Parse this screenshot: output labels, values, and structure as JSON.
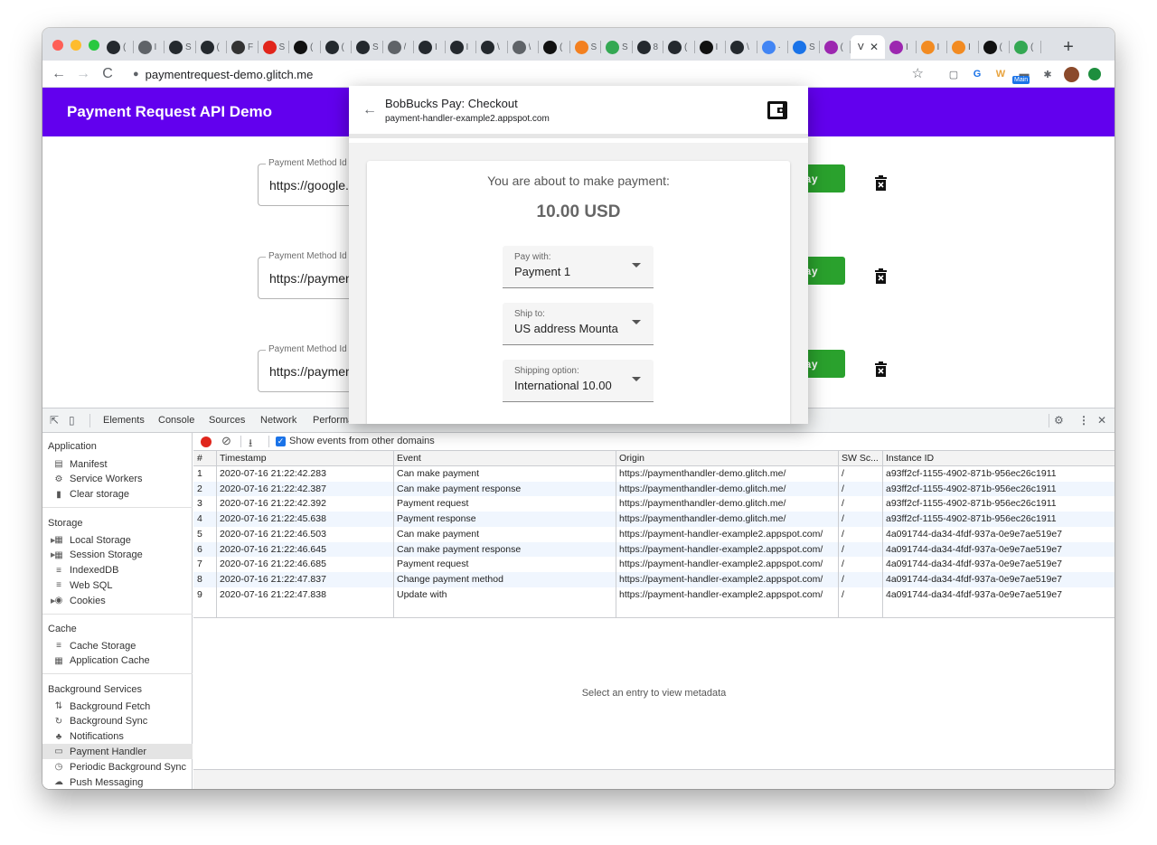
{
  "browser": {
    "tabs": [
      {
        "icon": "github-icon",
        "text": "(",
        "color": "#24292e"
      },
      {
        "icon": "globe-icon",
        "text": "I",
        "color": "#5f6368"
      },
      {
        "icon": "github-icon",
        "text": "S",
        "color": "#24292e"
      },
      {
        "icon": "github-icon",
        "text": "(",
        "color": "#24292e"
      },
      {
        "icon": "apple-dev-icon",
        "text": "F",
        "color": "#333333"
      },
      {
        "icon": "adobe-icon",
        "text": "S",
        "color": "#e1251b"
      },
      {
        "icon": "codepen-icon",
        "text": "(",
        "color": "#111111"
      },
      {
        "icon": "github-icon",
        "text": "(",
        "color": "#24292e"
      },
      {
        "icon": "github-icon",
        "text": "S",
        "color": "#24292e"
      },
      {
        "icon": "globe-icon",
        "text": "/",
        "color": "#5f6368"
      },
      {
        "icon": "github-icon",
        "text": "I",
        "color": "#24292e"
      },
      {
        "icon": "github-icon",
        "text": "I",
        "color": "#24292e"
      },
      {
        "icon": "github-icon",
        "text": "\\",
        "color": "#24292e"
      },
      {
        "icon": "globe-icon",
        "text": "\\",
        "color": "#5f6368"
      },
      {
        "icon": "nyt-icon",
        "text": "(",
        "color": "#111111"
      },
      {
        "icon": "cloudflare-icon",
        "text": "S",
        "color": "#f38020"
      },
      {
        "icon": "glitch-icon",
        "text": "S",
        "color": "#34a853"
      },
      {
        "icon": "github-icon",
        "text": "8",
        "color": "#24292e"
      },
      {
        "icon": "github-icon",
        "text": "(",
        "color": "#24292e"
      },
      {
        "icon": "notion-icon",
        "text": "I",
        "color": "#111111"
      },
      {
        "icon": "github-icon",
        "text": "\\",
        "color": "#24292e"
      },
      {
        "icon": "gcloud-icon",
        "text": "·",
        "color": "#4285f4"
      },
      {
        "icon": "terminal-icon",
        "text": "S",
        "color": "#1a73e8"
      },
      {
        "icon": "stack-icon",
        "text": "(",
        "color": "#9c27b0"
      },
      {
        "icon": "vue-tab",
        "text": "V",
        "color": "#ffffff",
        "active": true
      },
      {
        "icon": "stack-icon",
        "text": "I",
        "color": "#9c27b0"
      },
      {
        "icon": "w3-icon",
        "text": "I",
        "color": "#f28b22"
      },
      {
        "icon": "w3-icon",
        "text": "I",
        "color": "#f28b22"
      },
      {
        "icon": "square-icon",
        "text": "(",
        "color": "#111111"
      },
      {
        "icon": "glitch-icon",
        "text": "(",
        "color": "#34a853"
      }
    ],
    "url": "paymentrequest-demo.glitch.me",
    "extension_badge": "Main"
  },
  "page": {
    "title": "Payment Request API Demo",
    "method_label": "Payment Method Id",
    "rows": [
      {
        "value": "https://google.",
        "button": "ay"
      },
      {
        "value": "https://paymen",
        "button": "ay"
      },
      {
        "value": "https://paymen",
        "button": "ay"
      }
    ]
  },
  "dialog": {
    "title": "BobBucks Pay: Checkout",
    "origin": "payment-handler-example2.appspot.com",
    "message": "You are about to make payment:",
    "amount": "10.00 USD",
    "pay_with_label": "Pay with:",
    "pay_with_value": "Payment 1",
    "ship_to_label": "Ship to:",
    "ship_to_value": "US address Mountain View",
    "shipping_option_label": "Shipping option:",
    "shipping_option_value": "International 10.00"
  },
  "devtools": {
    "tabs": [
      "Elements",
      "Console",
      "Sources",
      "Network",
      "Performa"
    ],
    "sidebar": {
      "application_head": "Application",
      "application_items": [
        "Manifest",
        "Service Workers",
        "Clear storage"
      ],
      "storage_head": "Storage",
      "storage_items": [
        "Local Storage",
        "Session Storage",
        "IndexedDB",
        "Web SQL",
        "Cookies"
      ],
      "cache_head": "Cache",
      "cache_items": [
        "Cache Storage",
        "Application Cache"
      ],
      "bg_head": "Background Services",
      "bg_items": [
        "Background Fetch",
        "Background Sync",
        "Notifications",
        "Payment Handler",
        "Periodic Background Sync",
        "Push Messaging"
      ]
    },
    "toolbar_checkbox_label": "Show events from other domains",
    "columns": [
      "#",
      "Timestamp",
      "Event",
      "Origin",
      "SW Sc...",
      "Instance ID"
    ],
    "rows": [
      [
        "1",
        "2020-07-16 21:22:42.283",
        "Can make payment",
        "https://paymenthandler-demo.glitch.me/",
        "/",
        "a93ff2cf-1155-4902-871b-956ec26c1911"
      ],
      [
        "2",
        "2020-07-16 21:22:42.387",
        "Can make payment response",
        "https://paymenthandler-demo.glitch.me/",
        "/",
        "a93ff2cf-1155-4902-871b-956ec26c1911"
      ],
      [
        "3",
        "2020-07-16 21:22:42.392",
        "Payment request",
        "https://paymenthandler-demo.glitch.me/",
        "/",
        "a93ff2cf-1155-4902-871b-956ec26c1911"
      ],
      [
        "4",
        "2020-07-16 21:22:45.638",
        "Payment response",
        "https://paymenthandler-demo.glitch.me/",
        "/",
        "a93ff2cf-1155-4902-871b-956ec26c1911"
      ],
      [
        "5",
        "2020-07-16 21:22:46.503",
        "Can make payment",
        "https://payment-handler-example2.appspot.com/",
        "/",
        "4a091744-da34-4fdf-937a-0e9e7ae519e7"
      ],
      [
        "6",
        "2020-07-16 21:22:46.645",
        "Can make payment response",
        "https://payment-handler-example2.appspot.com/",
        "/",
        "4a091744-da34-4fdf-937a-0e9e7ae519e7"
      ],
      [
        "7",
        "2020-07-16 21:22:46.685",
        "Payment request",
        "https://payment-handler-example2.appspot.com/",
        "/",
        "4a091744-da34-4fdf-937a-0e9e7ae519e7"
      ],
      [
        "8",
        "2020-07-16 21:22:47.837",
        "Change payment method",
        "https://payment-handler-example2.appspot.com/",
        "/",
        "4a091744-da34-4fdf-937a-0e9e7ae519e7"
      ],
      [
        "9",
        "2020-07-16 21:22:47.838",
        "Update with",
        "https://payment-handler-example2.appspot.com/",
        "/",
        "4a091744-da34-4fdf-937a-0e9e7ae519e7"
      ]
    ],
    "metadata_placeholder": "Select an entry to view metadata"
  }
}
